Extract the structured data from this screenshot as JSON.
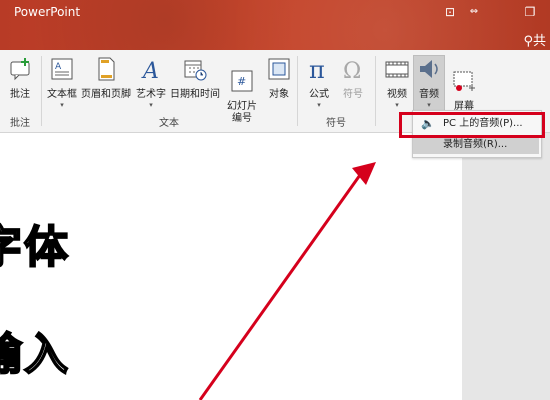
{
  "app": {
    "title": "PowerPoint",
    "user_initial": "共"
  },
  "window": {
    "restore_glyph": "⊡",
    "min_glyph": "❐"
  },
  "ribbon": {
    "groups": [
      {
        "name": "批注",
        "tools": [
          {
            "label": "批注",
            "icon": "comment-icon"
          }
        ]
      },
      {
        "name": "文本",
        "tools": [
          {
            "label": "文本框",
            "icon": "textbox-icon"
          },
          {
            "label": "页眉和页脚",
            "icon": "header-footer-icon"
          },
          {
            "label": "艺术字",
            "icon": "wordart-icon"
          },
          {
            "label": "日期和时间",
            "icon": "calendar-icon"
          },
          {
            "label": "幻灯片\n编号",
            "icon": "slide-number-icon"
          },
          {
            "label": "对象",
            "icon": "object-icon"
          }
        ]
      },
      {
        "name": "符号",
        "tools": [
          {
            "label": "公式",
            "icon": "equation-icon"
          },
          {
            "label": "符号",
            "icon": "symbol-icon"
          }
        ]
      },
      {
        "name": "",
        "tools": [
          {
            "label": "视频",
            "icon": "video-icon"
          },
          {
            "label": "音频",
            "icon": "audio-icon"
          },
          {
            "label": "屏幕\n录制",
            "icon": "screen-record-icon"
          }
        ]
      }
    ]
  },
  "dropdown": {
    "items": [
      {
        "label": "PC 上的音频(P)...",
        "icon": "speaker-icon"
      },
      {
        "label": "录制音频(R)..."
      }
    ]
  },
  "slide": {
    "line1": "字体",
    "line2": "输入"
  },
  "colors": {
    "title_bar": "#c7462c",
    "highlight": "#d5001c"
  }
}
